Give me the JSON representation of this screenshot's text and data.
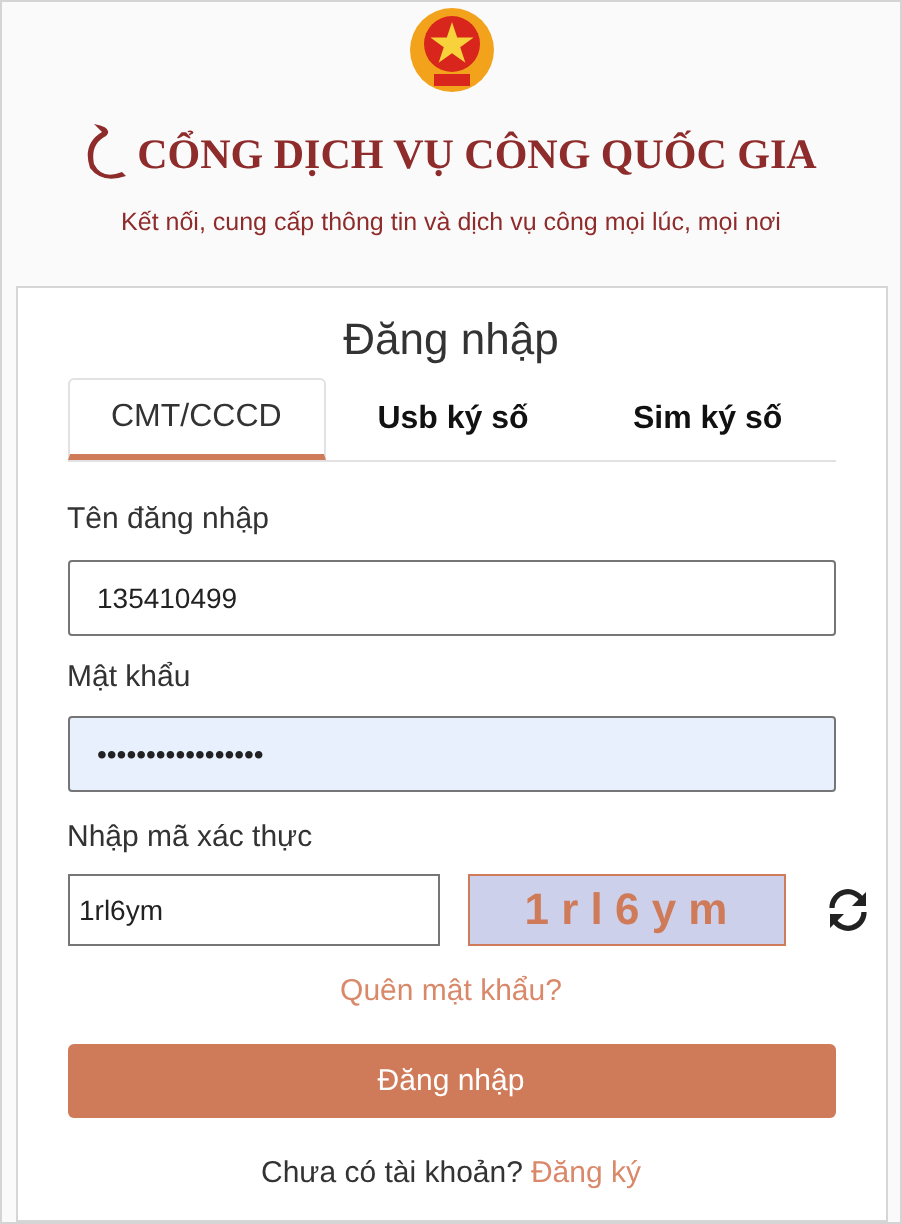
{
  "header": {
    "title": "CỔNG DỊCH VỤ CÔNG QUỐC GIA",
    "tagline": "Kết nối, cung cấp thông tin và dịch vụ công mọi lúc, mọi nơi"
  },
  "login": {
    "heading": "Đăng nhập",
    "tabs": [
      {
        "label": "CMT/CCCD",
        "selected": true
      },
      {
        "label": "Usb ký số",
        "selected": false
      },
      {
        "label": "Sim ký số",
        "selected": false
      }
    ],
    "fields": [
      {
        "label": "Tên đăng nhập",
        "value": "135410499",
        "autofilled": false
      },
      {
        "label": "Mật khẩu",
        "value": "•••••••••••••••••",
        "autofilled": true
      }
    ],
    "captcha": {
      "label": "Nhập mã xác thực",
      "value": "1rl6ym",
      "image_text": "1 r l 6 y m"
    },
    "forgot_link": "Quên mật khẩu?",
    "submit": "Đăng nhập",
    "signup_prompt": "Chưa có tài khoản?",
    "signup_link": "Đăng ký"
  }
}
